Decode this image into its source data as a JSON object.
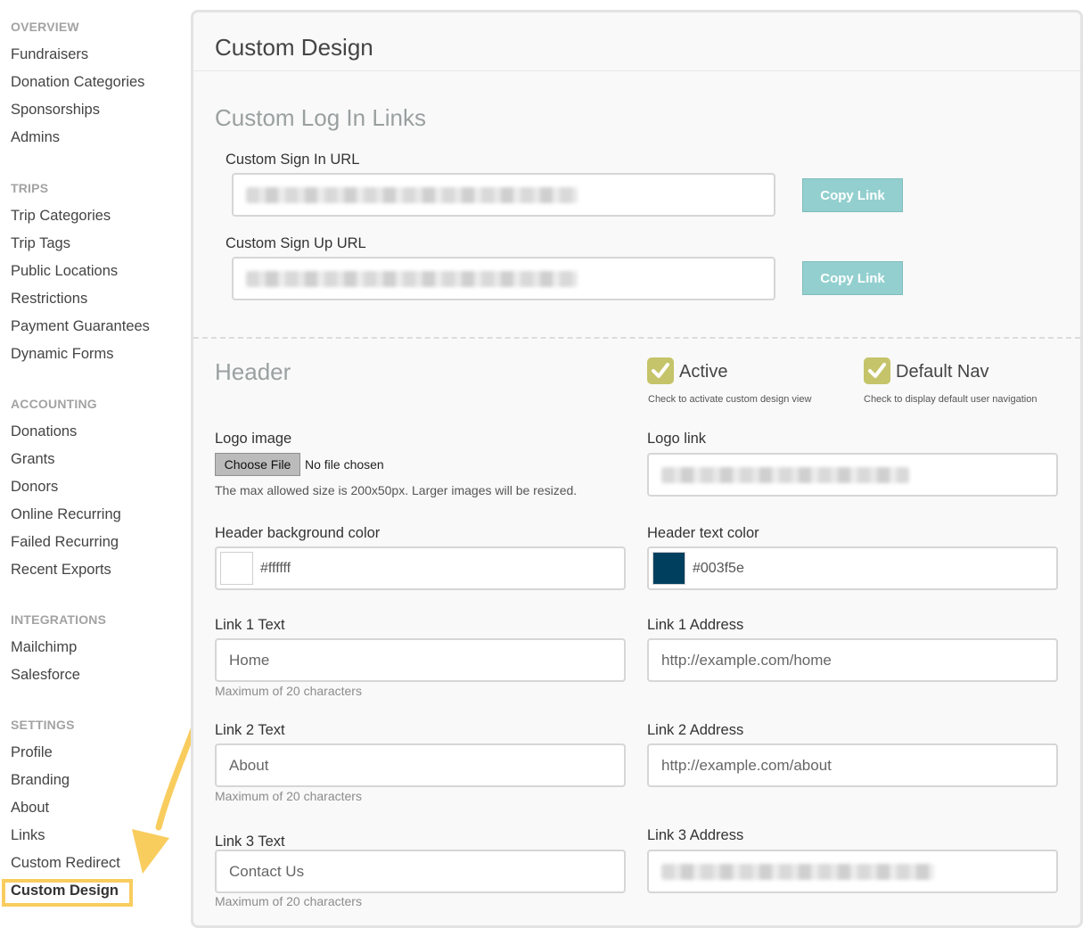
{
  "sidebar": {
    "sections": [
      {
        "title": "OVERVIEW",
        "items": [
          "Fundraisers",
          "Donation Categories",
          "Sponsorships",
          "Admins"
        ]
      },
      {
        "title": "TRIPS",
        "items": [
          "Trip Categories",
          "Trip Tags",
          "Public Locations",
          "Restrictions",
          "Payment Guarantees",
          "Dynamic Forms"
        ]
      },
      {
        "title": "ACCOUNTING",
        "items": [
          "Donations",
          "Grants",
          "Donors",
          "Online Recurring",
          "Failed Recurring",
          "Recent Exports"
        ]
      },
      {
        "title": "INTEGRATIONS",
        "items": [
          "Mailchimp",
          "Salesforce"
        ]
      },
      {
        "title": "SETTINGS",
        "items": [
          "Profile",
          "Branding",
          "About",
          "Links",
          "Custom Redirect",
          "Custom Design"
        ]
      }
    ],
    "active_item": "Custom Design"
  },
  "page": {
    "title": "Custom Design"
  },
  "login_links": {
    "title": "Custom Log In Links",
    "sign_in_label": "Custom Sign In URL",
    "sign_up_label": "Custom Sign Up URL",
    "copy_label": "Copy Link"
  },
  "header": {
    "title": "Header",
    "active": {
      "label": "Active",
      "hint": "Check to activate custom design view",
      "checked": true
    },
    "default_nav": {
      "label": "Default Nav",
      "hint": "Check to display default user navigation",
      "checked": true
    },
    "logo_image_label": "Logo image",
    "choose_file_label": "Choose File",
    "no_file_text": "No file chosen",
    "logo_hint": "The max allowed size is 200x50px. Larger images will be resized.",
    "logo_link_label": "Logo link",
    "bg_color_label": "Header background color",
    "bg_color_value": "#ffffff",
    "text_color_label": "Header text color",
    "text_color_value": "#003f5e",
    "max_chars_hint": "Maximum of 20 characters",
    "links": [
      {
        "text_label": "Link 1 Text",
        "text_value": "Home",
        "address_label": "Link 1 Address",
        "address_value": "http://example.com/home"
      },
      {
        "text_label": "Link 2 Text",
        "text_value": "About",
        "address_label": "Link 2 Address",
        "address_value": "http://example.com/about"
      },
      {
        "text_label": "Link 3 Text",
        "text_value": "Contact Us",
        "address_label": "Link 3 Address",
        "address_value": ""
      }
    ]
  },
  "colors": {
    "accent_teal": "#93cfcf",
    "check_olive": "#c5c46a",
    "highlight_yellow": "#f9cc5e",
    "header_text_swatch": "#003f5e"
  }
}
